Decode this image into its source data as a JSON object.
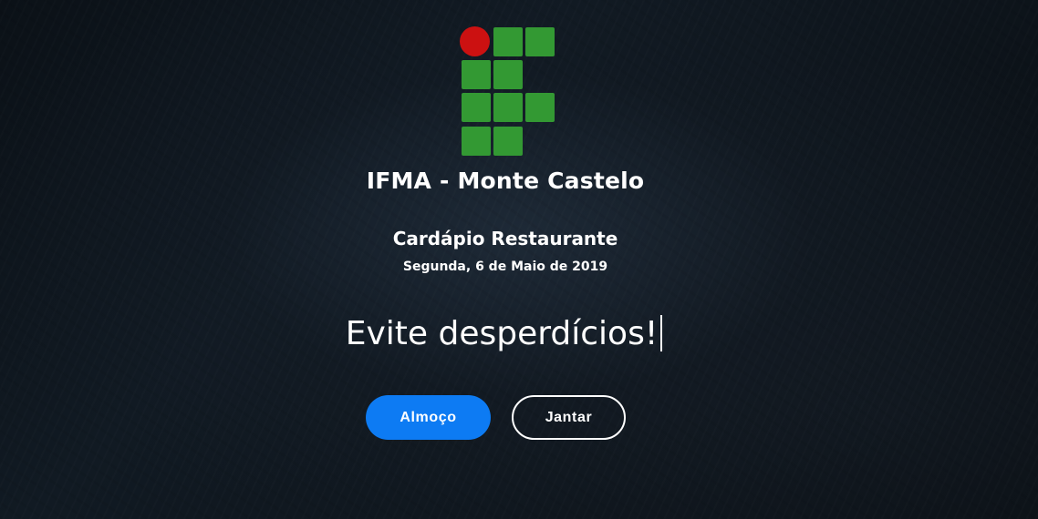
{
  "header": {
    "institution": "IFMA - Monte Castelo",
    "logo": {
      "name": "ifma-logo",
      "circle_color": "#cc1111",
      "square_color": "#339933"
    }
  },
  "menu": {
    "title": "Cardápio Restaurante",
    "date": "Segunda, 6 de Maio de 2019"
  },
  "slogan": {
    "text": "Evite desperdícios!"
  },
  "actions": {
    "lunch_label": "Almoço",
    "dinner_label": "Jantar"
  },
  "colors": {
    "primary_button": "#0d7bf3",
    "text": "#ffffff"
  }
}
